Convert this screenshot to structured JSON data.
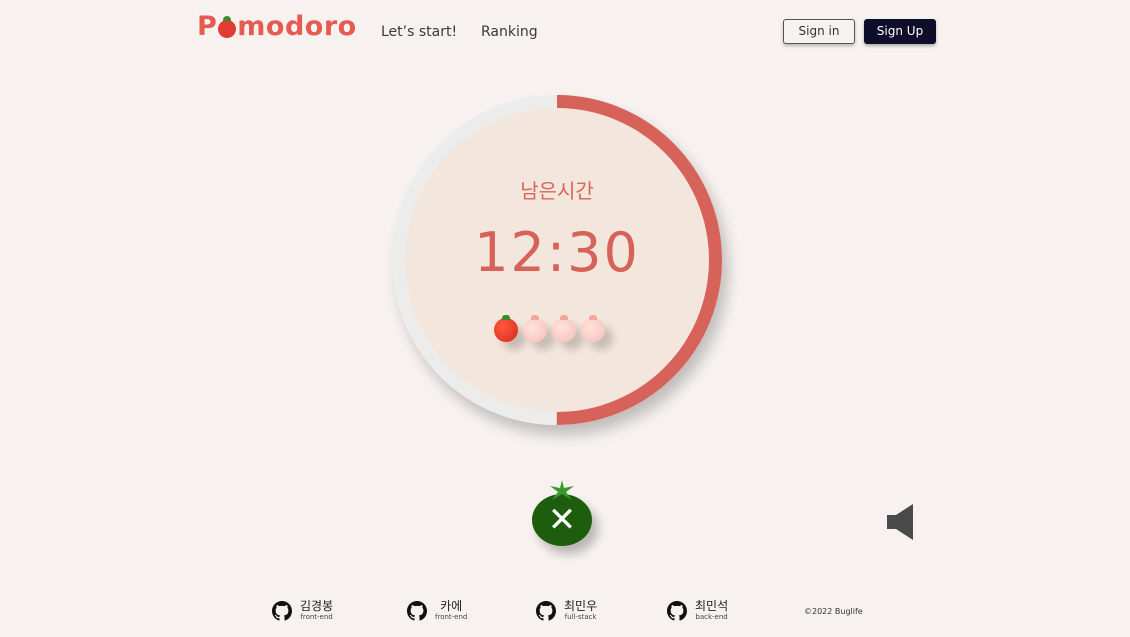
{
  "header": {
    "logo": {
      "prefix": "P",
      "suffix": "modoro"
    },
    "nav": {
      "start": "Let’s start!",
      "ranking": "Ranking"
    },
    "auth": {
      "sign_in": "Sign in",
      "sign_up": "Sign Up"
    }
  },
  "timer": {
    "label": "남은시간",
    "time": "12:30",
    "progress_fraction": 0.5,
    "tomatoes_total": 4,
    "tomatoes_filled": 1,
    "colors": {
      "track": "#ececec",
      "progress": "#d6625a",
      "inner": "#f3e6dc"
    }
  },
  "controls": {
    "stop_icon": "close-icon",
    "sound_icon": "speaker-icon"
  },
  "footer": {
    "members": [
      {
        "name": "김경봉",
        "role": "front-end"
      },
      {
        "name": "카에",
        "role": "front-end"
      },
      {
        "name": "최민우",
        "role": "full-stack"
      },
      {
        "name": "최민석",
        "role": "back-end"
      }
    ],
    "copyright": "©2022 Buglife"
  }
}
